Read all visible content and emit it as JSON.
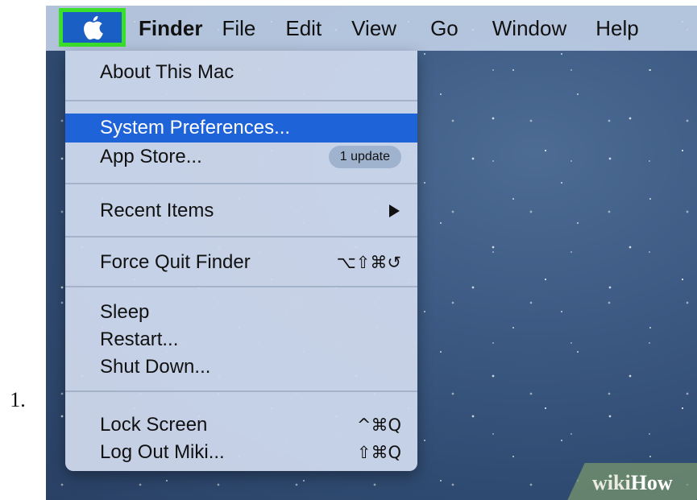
{
  "step": {
    "number": "1."
  },
  "menubar": {
    "apple_icon": "apple-logo-icon",
    "titles": [
      "Finder",
      "File",
      "Edit",
      "View",
      "Go",
      "Window",
      "Help"
    ]
  },
  "apple_menu": {
    "about": "About This Mac",
    "system_prefs": "System Preferences...",
    "app_store": "App Store...",
    "app_store_badge": "1 update",
    "recent_items": "Recent Items",
    "force_quit": "Force Quit Finder",
    "force_quit_shortcut": "⌥⇧⌘↺",
    "sleep": "Sleep",
    "restart": "Restart...",
    "shut_down": "Shut Down...",
    "lock_screen": "Lock Screen",
    "lock_screen_shortcut": "^⌘Q",
    "log_out": "Log Out Miki...",
    "log_out_shortcut": "⇧⌘Q"
  },
  "watermark": {
    "wiki": "wiki",
    "how": "How"
  },
  "colors": {
    "highlight": "#1f63d8",
    "apple_box_border": "#3be02a",
    "apple_box_fill": "#1a5fc4"
  }
}
